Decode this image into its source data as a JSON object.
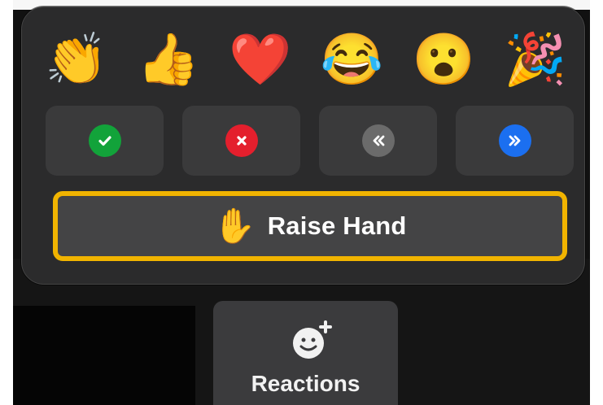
{
  "reactions_popover": {
    "emojis": [
      {
        "name": "clapping-hands-icon",
        "glyph": "👏"
      },
      {
        "name": "thumbs-up-icon",
        "glyph": "👍"
      },
      {
        "name": "heart-icon",
        "glyph": "❤️"
      },
      {
        "name": "tears-of-joy-icon",
        "glyph": "😂"
      },
      {
        "name": "surprised-face-icon",
        "glyph": "😮"
      },
      {
        "name": "party-popper-icon",
        "glyph": "🎉"
      }
    ],
    "status_buttons": [
      {
        "name": "yes-button",
        "icon": "checkmark-icon",
        "color": "#12a33a"
      },
      {
        "name": "no-button",
        "icon": "x-icon",
        "color": "#e41f2d"
      },
      {
        "name": "go-slower-button",
        "icon": "double-chevron-left-icon",
        "color": "#6b6b6b"
      },
      {
        "name": "go-faster-button",
        "icon": "double-chevron-right-icon",
        "color": "#1b6ff0"
      }
    ],
    "raise_hand": {
      "icon": "raised-hand-icon",
      "glyph": "✋",
      "label": "Raise Hand",
      "highlight_color": "#f1b400"
    }
  },
  "toolbar": {
    "reactions": {
      "icon": "add-reaction-icon",
      "label": "Reactions"
    }
  }
}
